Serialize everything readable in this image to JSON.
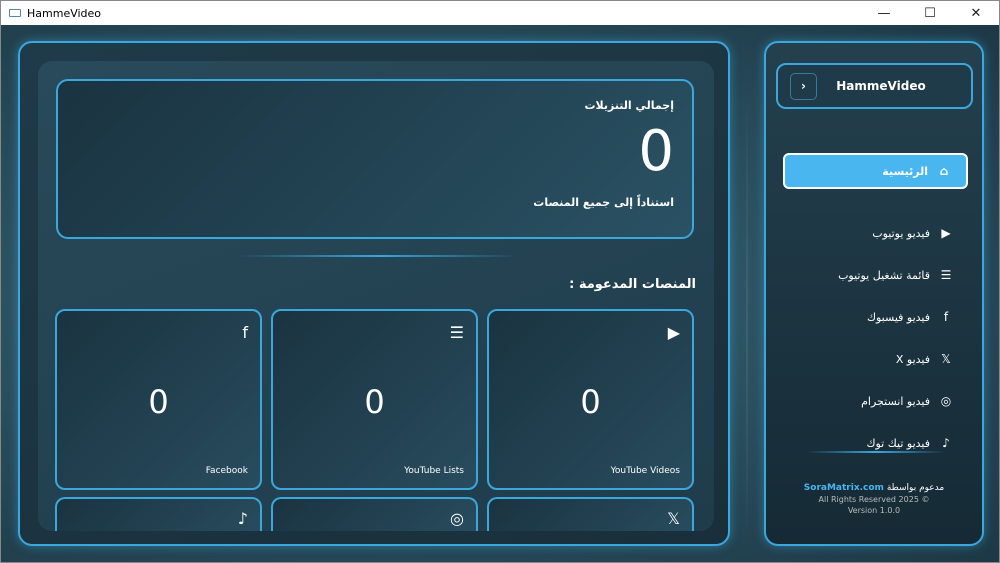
{
  "window": {
    "title": "HammeVideo",
    "minimize": "—",
    "maximize": "☐",
    "close": "✕"
  },
  "summary": {
    "label": "إجمالي التنزيلات",
    "value": "0",
    "subtitle": "استناداً إلى جميع المنصات"
  },
  "platforms_title": "المنصات المدعومة :",
  "platforms": [
    {
      "name": "YouTube Videos",
      "value": "0",
      "icon": "youtube-icon",
      "glyph": "▶"
    },
    {
      "name": "YouTube Lists",
      "value": "0",
      "icon": "list-icon",
      "glyph": "☰"
    },
    {
      "name": "Facebook",
      "value": "0",
      "icon": "facebook-icon",
      "glyph": "f"
    },
    {
      "name": "",
      "value": "",
      "icon": "x-icon",
      "glyph": "𝕏"
    },
    {
      "name": "",
      "value": "",
      "icon": "instagram-icon",
      "glyph": "◎"
    },
    {
      "name": "",
      "value": "",
      "icon": "tiktok-icon",
      "glyph": "♪"
    }
  ],
  "sidebar": {
    "brand": "HammeVideo",
    "toggle": "›",
    "items": [
      {
        "label": "الرئيسية",
        "icon": "home-icon",
        "glyph": "⌂"
      },
      {
        "label": "فيديو يوتيوب",
        "icon": "youtube-icon",
        "glyph": "▶"
      },
      {
        "label": "قائمة تشغيل يوتيوب",
        "icon": "list-icon",
        "glyph": "☰"
      },
      {
        "label": "فيديو فيسبوك",
        "icon": "facebook-icon",
        "glyph": "f"
      },
      {
        "label": "فيديو X",
        "icon": "x-icon",
        "glyph": "𝕏"
      },
      {
        "label": "فيديو انستجرام",
        "icon": "instagram-icon",
        "glyph": "◎"
      },
      {
        "label": "فيديو تيك توك",
        "icon": "tiktok-icon",
        "glyph": "♪"
      }
    ],
    "footer": {
      "powered": "مدعوم بواسطة",
      "link": "SoraMatrix.com",
      "rights": "All Rights Reserved 2025 ©",
      "version": "Version 1.0.0"
    }
  },
  "colors": {
    "accent": "#3aa7dd",
    "active": "#4ab6ef"
  }
}
